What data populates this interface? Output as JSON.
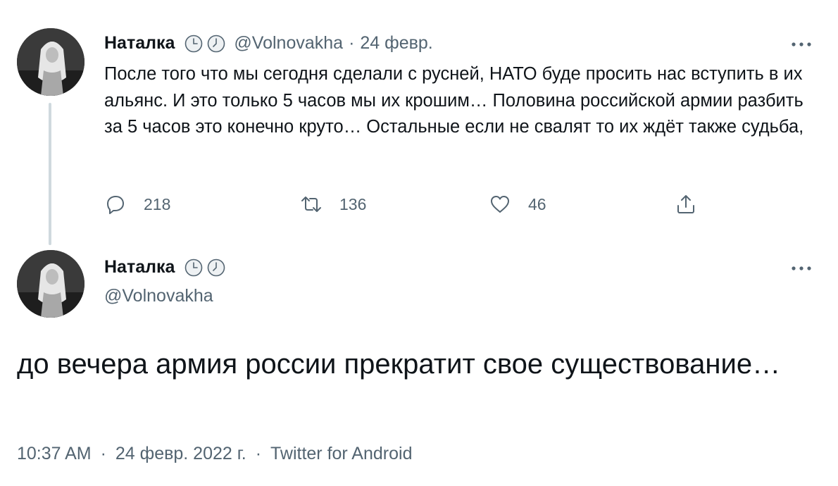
{
  "reply_tweet": {
    "author_name": "Наталка",
    "handle": "@Volnovakha",
    "separator": "·",
    "date": "24 февр.",
    "text": "После того что мы сегодня сделали с русней, НАТО буде просить нас вступить в их альянс. И это только 5 часов мы их крошим… Половина российской армии разбить за 5 часов это конечно круто… Остальные если не свалят то их ждёт также судьба,",
    "stats": {
      "replies": "218",
      "retweets": "136",
      "likes": "46"
    },
    "icons": [
      "reply-icon",
      "retweet-icon",
      "like-icon",
      "share-icon",
      "more-icon",
      "clock-badge-icon"
    ]
  },
  "main_tweet": {
    "author_name": "Наталка",
    "handle": "@Volnovakha",
    "text": "до вечера армия россии прекратит свое существование…",
    "time": "10:37 AM",
    "date": "24 февр. 2022 г.",
    "source": "Twitter for Android",
    "separator": "·"
  },
  "colors": {
    "text_primary": "#0f1419",
    "text_secondary": "#536471",
    "thread_line": "#cfd9de",
    "background": "#ffffff"
  }
}
